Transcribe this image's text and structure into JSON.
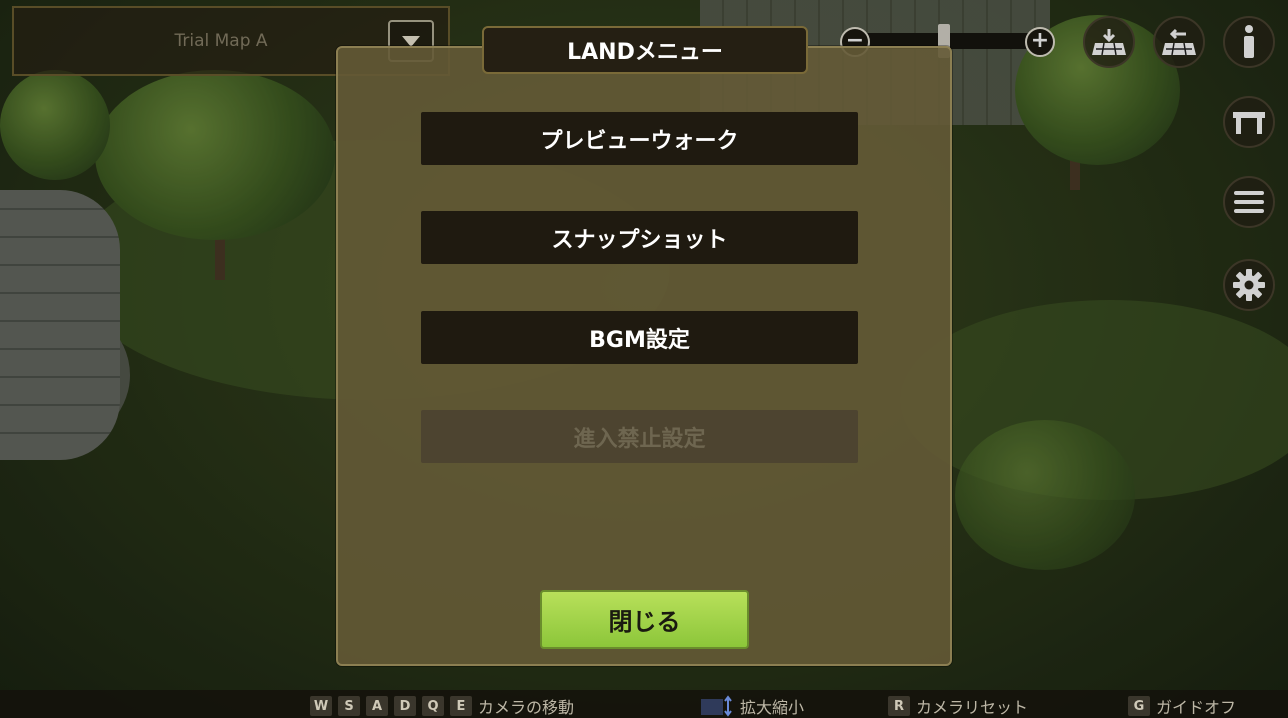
{
  "map_selector": {
    "value": "Trial Map A"
  },
  "dialog": {
    "title": "LANDメニュー",
    "items": [
      {
        "label": "プレビューウォーク",
        "enabled": true
      },
      {
        "label": "スナップショット",
        "enabled": true
      },
      {
        "label": "BGM設定",
        "enabled": true
      },
      {
        "label": "進入禁止設定",
        "enabled": false
      }
    ],
    "close_label": "閉じる"
  },
  "zoom": {
    "minus": "−",
    "plus": "+"
  },
  "right_icons": [
    "download-grid-icon",
    "upload-grid-icon",
    "info-icon",
    "table-icon",
    "menu-icon",
    "gear-icon"
  ],
  "hints": {
    "move_keys": [
      "W",
      "S",
      "A",
      "D",
      "Q",
      "E"
    ],
    "move_label": "カメラの移動",
    "zoom_label": "拡大縮小",
    "reset_key": "R",
    "reset_label": "カメラリセット",
    "guide_key": "G",
    "guide_label": "ガイドオフ"
  },
  "colors": {
    "accent_green": "#8cc63a",
    "panel": "#645a36"
  }
}
